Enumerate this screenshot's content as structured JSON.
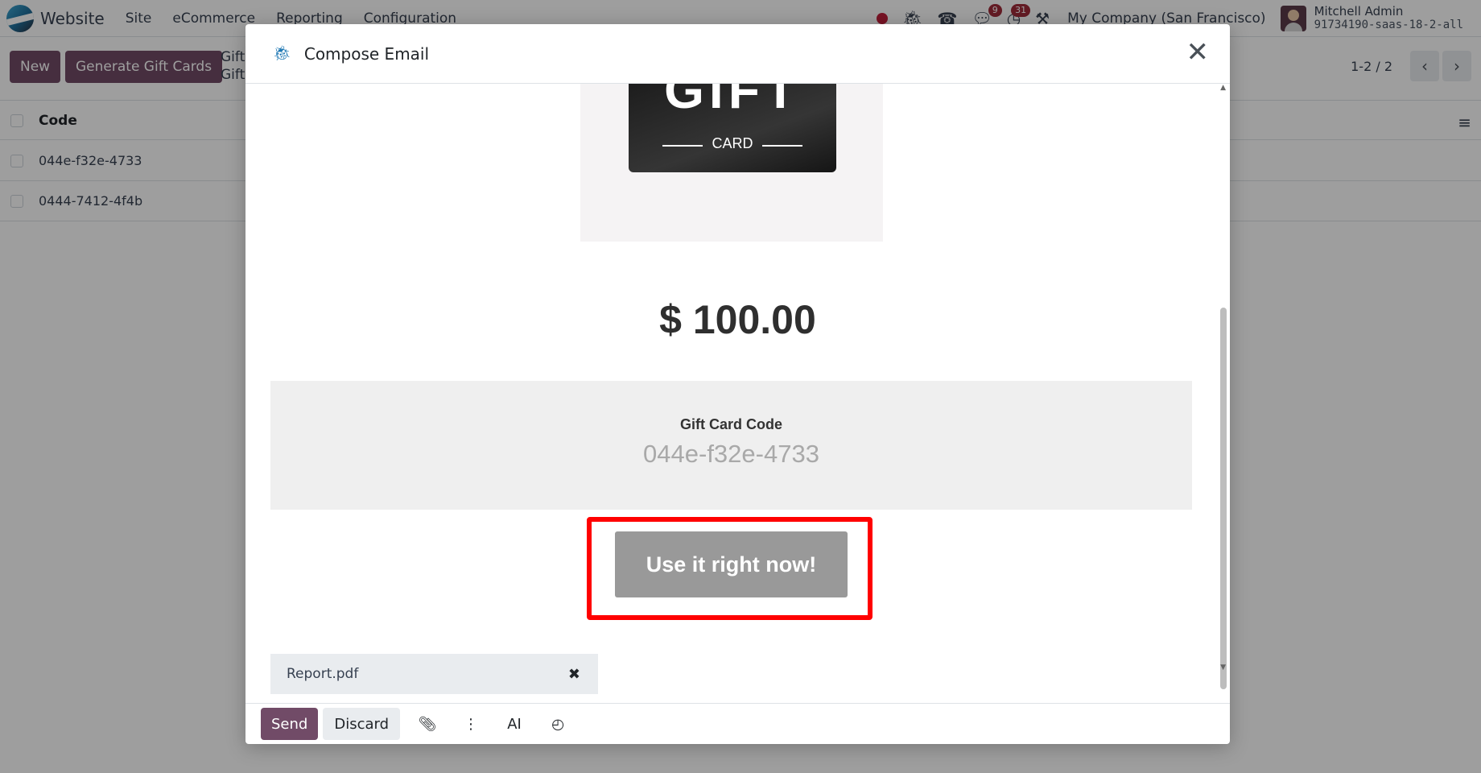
{
  "app": {
    "name": "Website"
  },
  "menu": [
    "Site",
    "eCommerce",
    "Reporting",
    "Configuration"
  ],
  "systray": {
    "chat_badge": "9",
    "activity_badge": "31",
    "company": "My Company (San Francisco)",
    "user_name": "Mitchell Admin",
    "database": "91734190-saas-18-2-all"
  },
  "controlbar": {
    "new_label": "New",
    "generate_label": "Generate Gift Cards",
    "breadcrumb_line1": "Gift",
    "breadcrumb_line2": "Gift",
    "pager": "1-2 / 2"
  },
  "list": {
    "column": "Code",
    "rows": [
      "044e-f32e-4733",
      "0444-7412-4f4b"
    ]
  },
  "modal": {
    "title": "Compose Email",
    "card_word_big": "GIFT",
    "card_word_small": "CARD",
    "amount": "$ 100.00",
    "code_label": "Gift Card Code",
    "code_value": "044e-f32e-4733",
    "use_button": "Use it right now!",
    "attachment": "Report.pdf"
  },
  "footer": {
    "send": "Send",
    "discard": "Discard",
    "ai": "AI"
  },
  "colors": {
    "primary": "#714b67",
    "highlight": "#ff0000",
    "badge": "#a12d3b"
  }
}
